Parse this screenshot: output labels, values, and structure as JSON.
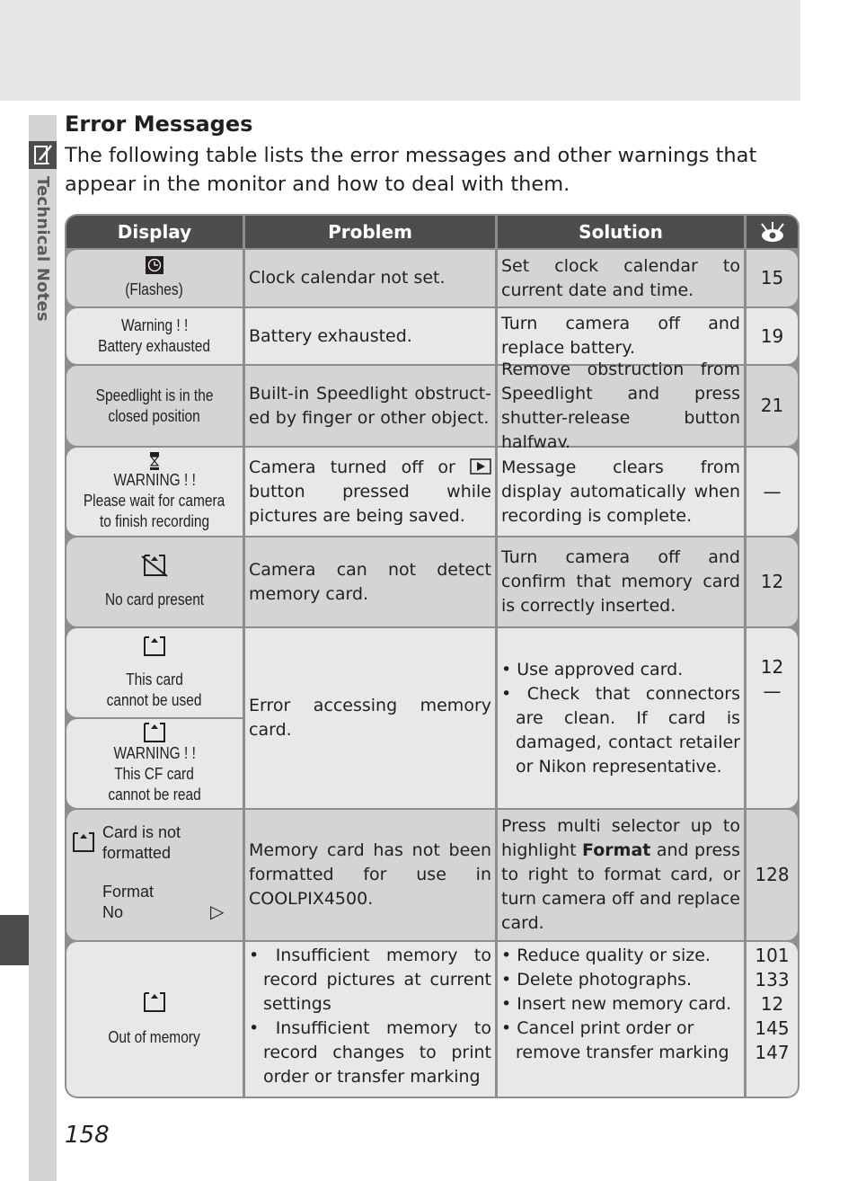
{
  "side": {
    "section_label": "Technical Notes",
    "icon": "pencil-note-icon"
  },
  "page": {
    "title": "Error Messages",
    "intro": "The following table lists the error messages and other warnings that appear in the monitor and how to deal with them.",
    "page_number": "158"
  },
  "table": {
    "headers": {
      "display": "Display",
      "problem": "Problem",
      "solution": "Solution",
      "ref_icon": "reference-eye-icon"
    },
    "rows": [
      {
        "display_icon": "clock-icon",
        "display": [
          "(Flashes)"
        ],
        "problem": "Clock calendar not set.",
        "solution": "Set clock calendar to current date and time.",
        "ref": "15"
      },
      {
        "display": [
          "Warning ! !",
          "Battery exhausted"
        ],
        "problem": "Battery exhausted.",
        "solution": "Turn camera off and replace battery.",
        "ref": "19"
      },
      {
        "display": [
          "Speedlight is in the",
          "closed position"
        ],
        "problem": "Built-in Speedlight obstruct-ed by finger or other object.",
        "solution": "Remove obstruction from Speedlight and press shutter-release button halfway.",
        "ref": "21"
      },
      {
        "display_icon": "hourglass-icon",
        "display": [
          "WARNING ! !",
          "Please wait for camera",
          "to finish recording"
        ],
        "problem_before": "Camera turned off or",
        "problem_icon": "play-button-icon",
        "problem_after": "button pressed while pictures are being saved.",
        "solution": "Message clears from display automatically when recording is complete.",
        "ref": "—"
      },
      {
        "display_icon": "no-card-icon",
        "display": [
          "No card present"
        ],
        "problem": "Camera can not detect memory card.",
        "solution": "Turn camera off and confirm that memory card is correctly inserted.",
        "ref": "12"
      },
      {
        "display_sub": [
          {
            "icon": "memory-card-icon",
            "lines": [
              "This card",
              "cannot be used"
            ]
          },
          {
            "icon": "memory-card-icon",
            "lines": [
              "WARNING ! !",
              "This CF card",
              "cannot be read"
            ]
          }
        ],
        "problem": "Error accessing memory card.",
        "solution_bullets": [
          "Use approved card.",
          "Check that connectors are clean.  If card is damaged, contact retailer or Nikon representative."
        ],
        "refs": [
          "12",
          "—"
        ]
      },
      {
        "display_icon": "memory-card-icon",
        "display": [
          "Card is not",
          "formatted"
        ],
        "display_menu": [
          "Format",
          "No"
        ],
        "display_arrow": "▷",
        "problem": "Memory card has not been formatted for use in COOLPIX4500.",
        "solution_before": "Press multi selector up to highlight",
        "solution_bold": "Format",
        "solution_after": "and press to right to format card, or turn camera off and replace card.",
        "ref": "128"
      },
      {
        "display_icon": "memory-card-icon",
        "display": [
          "Out of memory"
        ],
        "problem_bullets": [
          "Insufficient memory to record pictures at current settings",
          "Insufficient memory to record changes to print order or transfer marking"
        ],
        "solution_bullets": [
          "Reduce quality or size.",
          "Delete photographs.",
          "Insert new memory card.",
          "Cancel print order or remove transfer marking"
        ],
        "refs": [
          "101",
          "133",
          "12",
          "145",
          "147"
        ]
      }
    ]
  }
}
